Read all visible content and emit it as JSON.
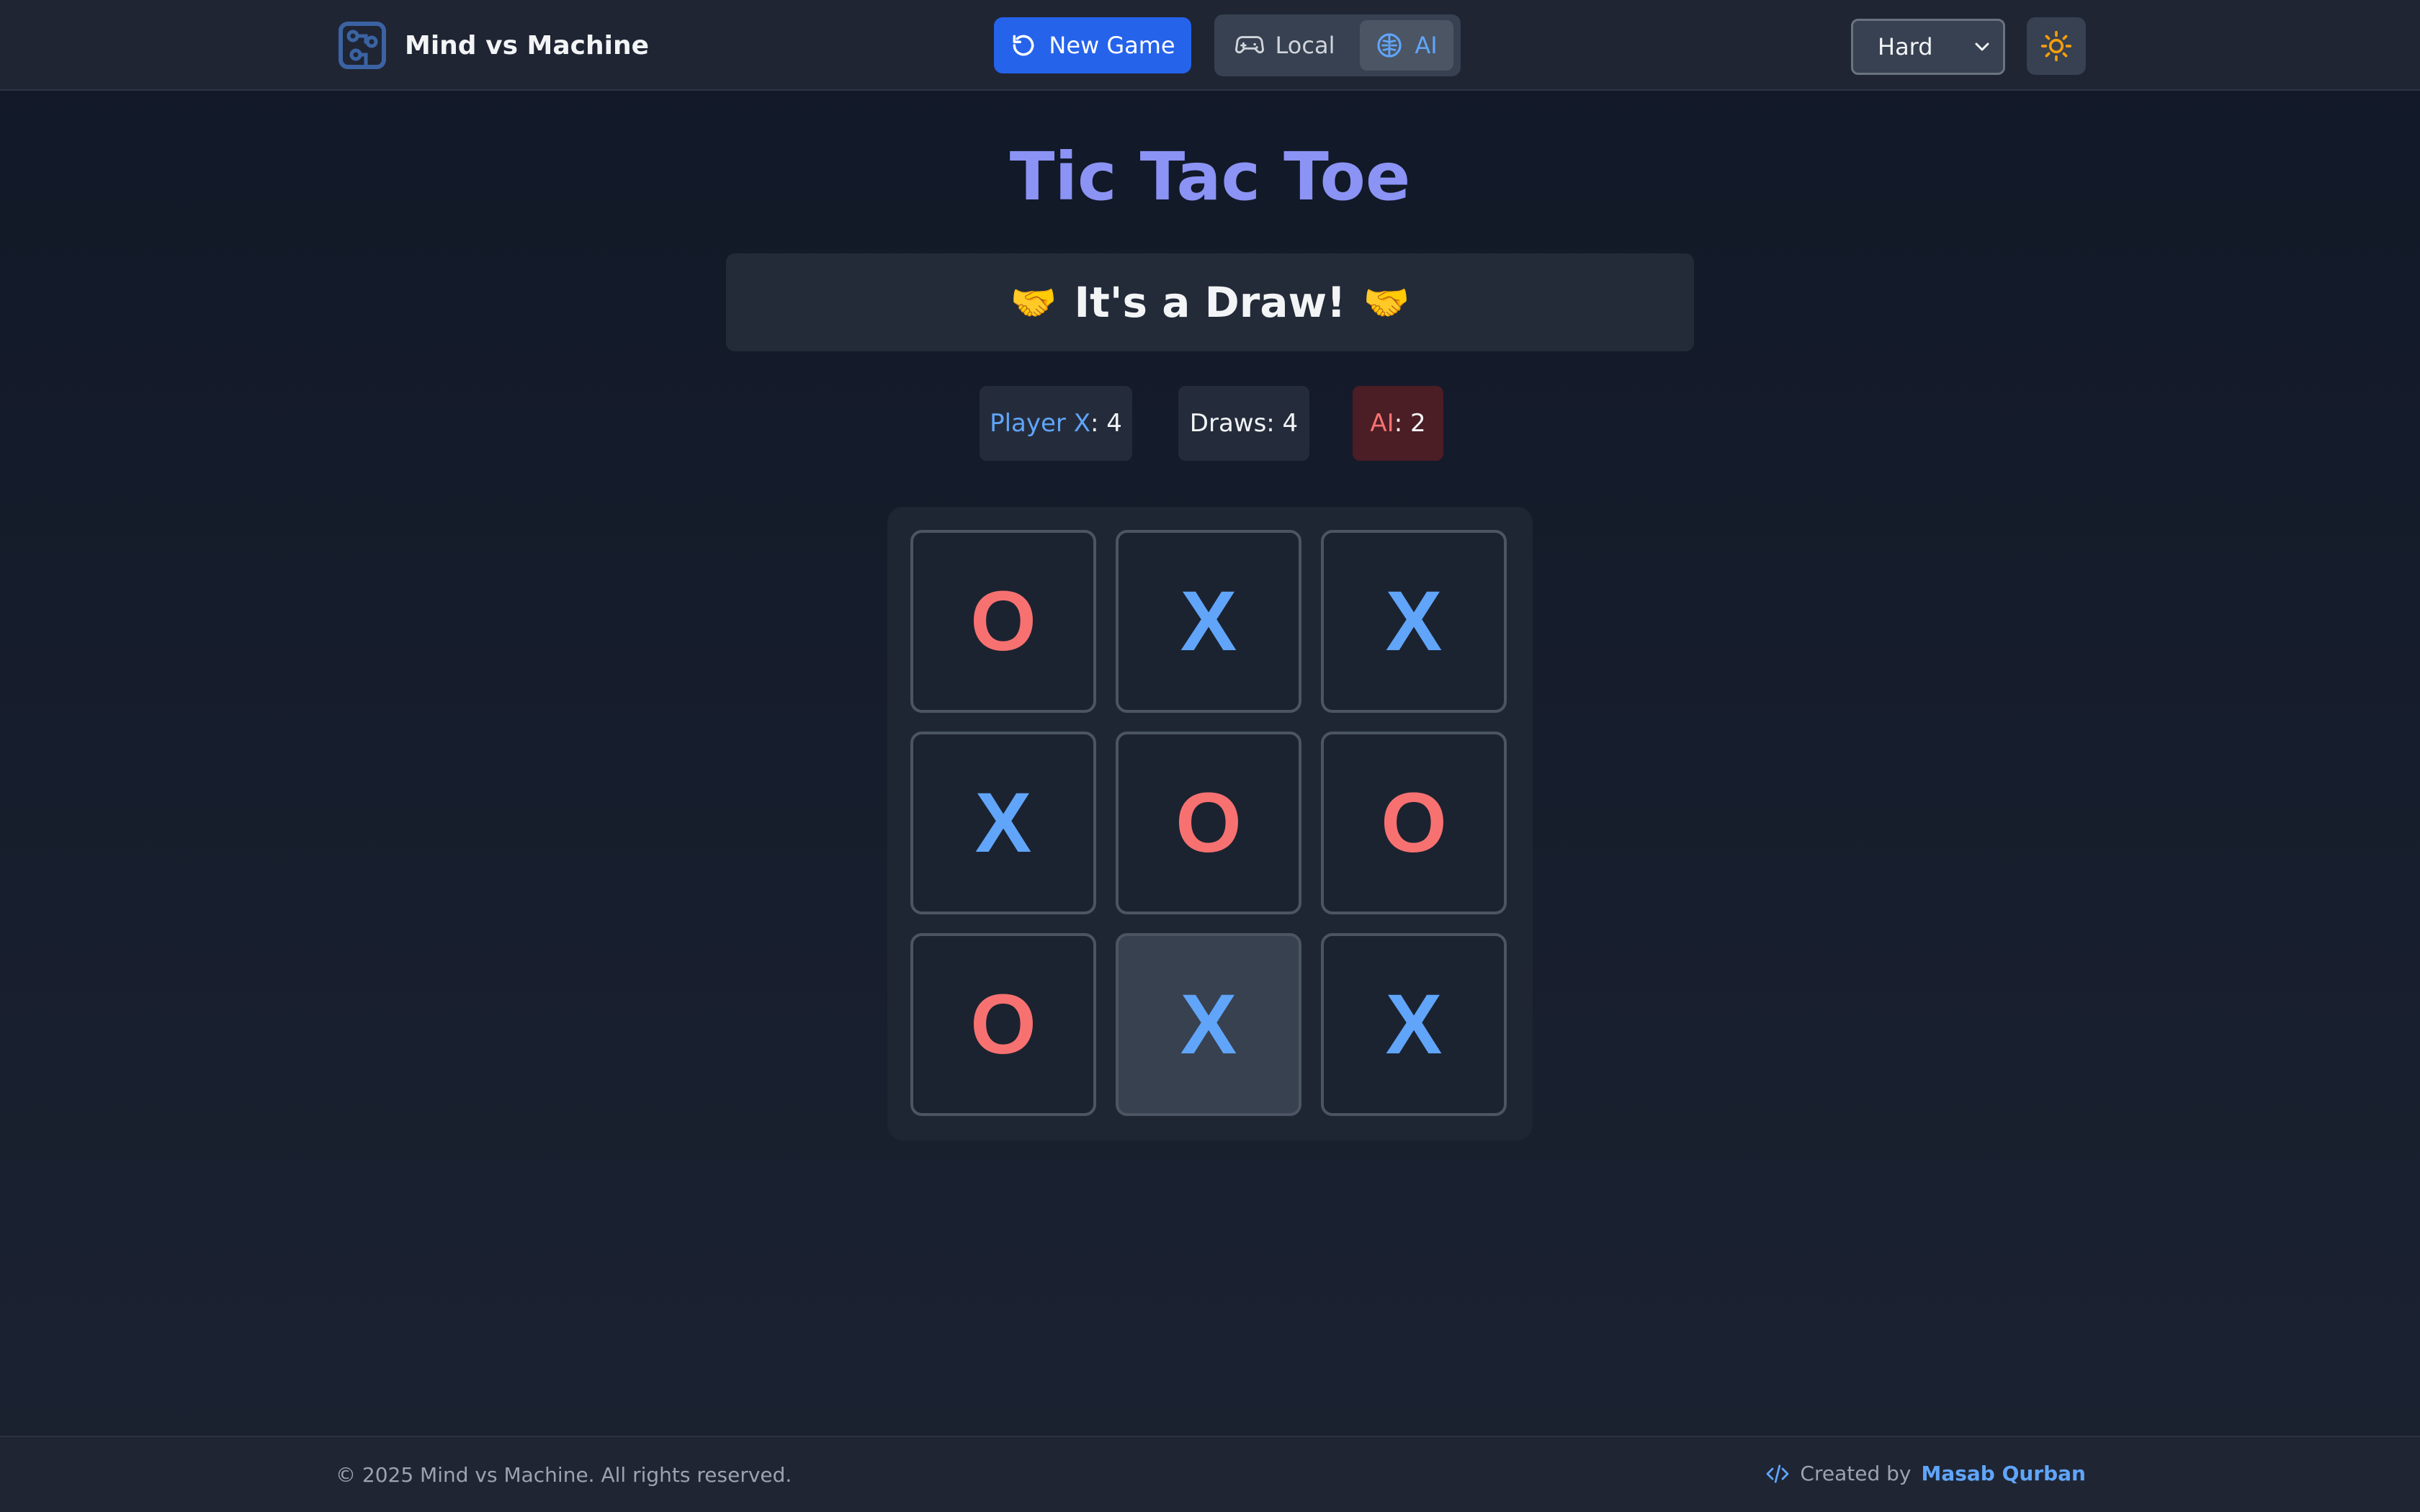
{
  "header": {
    "brand": "Mind vs Machine",
    "new_game_label": "New Game",
    "modes": [
      {
        "label": "Local",
        "icon": "gamepad-icon",
        "active": false
      },
      {
        "label": "AI",
        "icon": "brain-icon",
        "active": true
      }
    ],
    "difficulty": "Hard",
    "theme_icon": "sun-icon"
  },
  "main": {
    "title": "Tic Tac Toe",
    "status_emoji": "🤝",
    "status_text": "It's a Draw!",
    "scores": {
      "x_label": "Player X",
      "x_value": ": 4",
      "draws_label": "Draws: 4",
      "ai_label": "AI",
      "ai_value": ": 2"
    },
    "board": [
      "O",
      "X",
      "X",
      "X",
      "O",
      "O",
      "O",
      "X",
      "X"
    ]
  },
  "footer": {
    "copyright": "© 2025 Mind vs Machine. All rights reserved.",
    "credit_prefix": "Created by",
    "author": "Masab Qurban"
  },
  "colors": {
    "accent": "#2563eb",
    "title": "#8b93f5",
    "x_mark": "#60a5fa",
    "o_mark": "#f87171",
    "theme_sun": "#f59e0b"
  }
}
